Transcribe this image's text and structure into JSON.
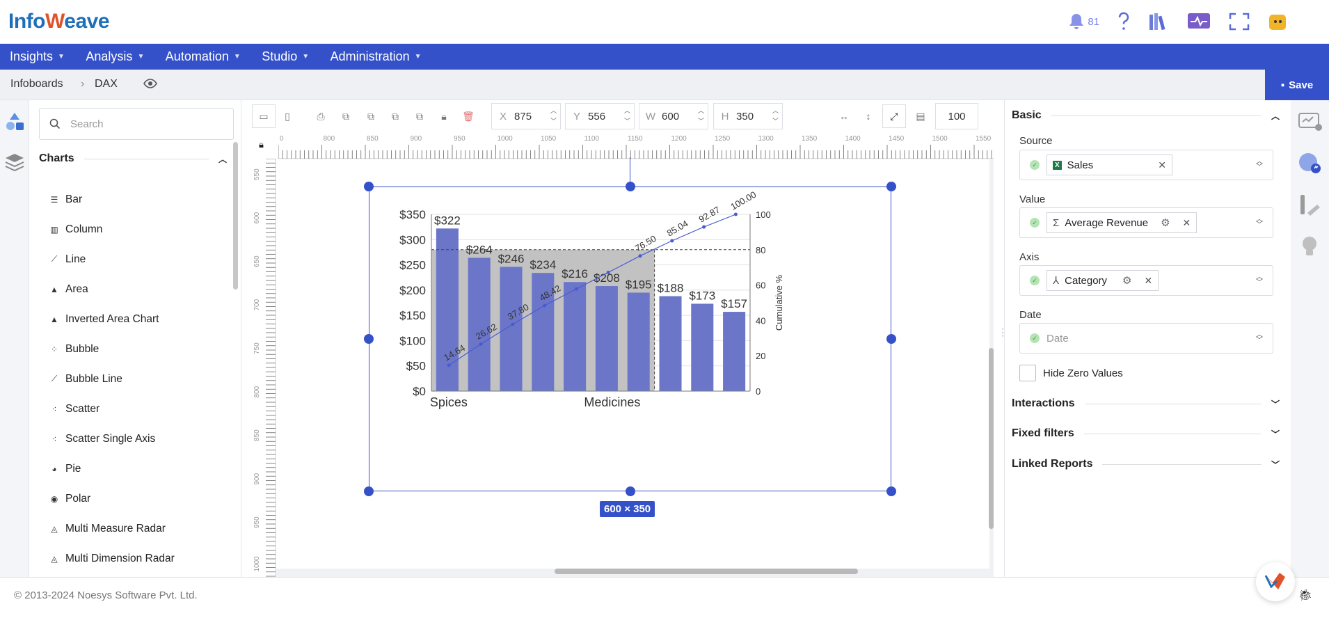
{
  "app": {
    "logo_part1": "Info",
    "logo_part2": "eave",
    "notification_count": "81"
  },
  "nav": [
    "Insights",
    "Analysis",
    "Automation",
    "Studio",
    "Administration"
  ],
  "breadcrumb": {
    "root": "Infoboards",
    "current": "DAX"
  },
  "toolbar": {
    "save_label": "Save",
    "x_label": "X",
    "x_value": "875",
    "y_label": "Y",
    "y_value": "556",
    "w_label": "W",
    "w_value": "600",
    "h_label": "H",
    "h_value": "350",
    "zoom": "100"
  },
  "left_panel": {
    "search_placeholder": "Search",
    "section_title": "Charts",
    "items": [
      "Bar",
      "Column",
      "Line",
      "Area",
      "Inverted Area Chart",
      "Bubble",
      "Bubble Line",
      "Scatter",
      "Scatter Single Axis",
      "Pie",
      "Polar",
      "Multi Measure Radar",
      "Multi Dimension Radar"
    ]
  },
  "rulers": {
    "top": [
      "0",
      "800",
      "850",
      "900",
      "950",
      "1000",
      "1050",
      "1100",
      "1150",
      "1200",
      "1250",
      "1300",
      "1350",
      "1400",
      "1450",
      "1500",
      "1550"
    ],
    "left": [
      "550",
      "600",
      "650",
      "700",
      "750",
      "800",
      "850",
      "900",
      "950",
      "1000"
    ]
  },
  "size_badge": "600 × 350",
  "chart_data": {
    "type": "bar",
    "categories": [
      "Spices",
      "",
      "",
      "",
      "",
      "Medicines",
      "",
      "",
      "",
      ""
    ],
    "x_tick_labels": [
      "Spices",
      "Medicines"
    ],
    "values": [
      322,
      264,
      246,
      234,
      216,
      208,
      195,
      188,
      173,
      157
    ],
    "value_labels": [
      "$322",
      "$264",
      "$246",
      "$234",
      "$216",
      "$208",
      "$195",
      "$188",
      "$173",
      "$157"
    ],
    "y_ticks": [
      "$0",
      "$50",
      "$100",
      "$150",
      "$200",
      "$250",
      "$300",
      "$350"
    ],
    "ylim": [
      0,
      350
    ],
    "cumulative": [
      14.64,
      26.62,
      37.8,
      48.42,
      null,
      null,
      76.5,
      85.04,
      92.87,
      100.0
    ],
    "cumulative_labels": [
      "14.64",
      "26.62",
      "37.80",
      "48.42",
      "",
      "",
      "76.50",
      "85.04",
      "92.87",
      "100.00"
    ],
    "y2_ticks": [
      "0",
      "20",
      "40",
      "60",
      "80",
      "100"
    ],
    "y2lim": [
      0,
      100
    ],
    "y2label": "Cumulative %",
    "threshold_percent": 80,
    "colors": {
      "bar": "#6b76c9",
      "line": "#4a5bd0",
      "shade": "#c2c2c2"
    }
  },
  "right_panel": {
    "basic_title": "Basic",
    "source_label": "Source",
    "source_value": "Sales",
    "value_label": "Value",
    "value_value": "Average Revenue",
    "axis_label": "Axis",
    "axis_value": "Category",
    "date_label": "Date",
    "date_placeholder": "Date",
    "hide_zero_label": "Hide Zero Values",
    "interactions_title": "Interactions",
    "fixed_filters_title": "Fixed filters",
    "linked_reports_title": "Linked Reports"
  },
  "footer": {
    "copyright": "© 2013-2024 Noesys Software Pvt. Ltd."
  }
}
